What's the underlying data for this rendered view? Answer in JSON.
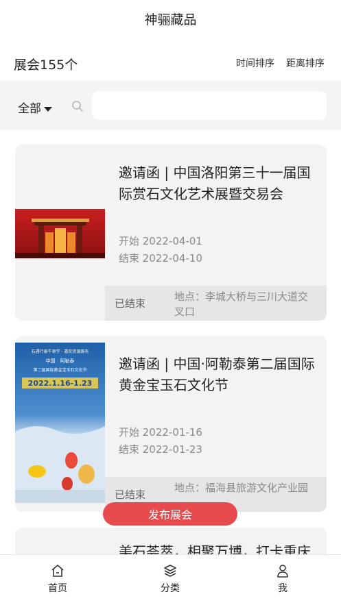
{
  "app": {
    "title": "神骊藏品"
  },
  "summary": {
    "count_label": "展会155个",
    "sort_time": "时间排序",
    "sort_distance": "距离排序"
  },
  "filter": {
    "category": "全部",
    "search_placeholder": "",
    "search_icon": "search-icon"
  },
  "exhibitions": [
    {
      "title": "邀请函 | 中国洛阳第三十一届国际赏石文化艺术展暨交易会",
      "start": "开始 2022-04-01",
      "end": "结束 2022-04-10",
      "status": "已结束",
      "location": "地点：李城大桥与三川大道交叉口"
    },
    {
      "title": "邀请函 | 中国·阿勒泰第二届国际黄金宝玉石文化节",
      "start": "开始 2022-01-16",
      "end": "结束 2022-01-23",
      "status": "已结束",
      "location": "地点：福海县旅游文化产业园",
      "poster": {
        "slogan": "石遇行泰牛顿学 · 邀实资源兼有",
        "org": "中国 · 阿勒泰",
        "event": "第二届国际黄金宝玉石文化节",
        "dates": "2022.1.16-1.23"
      }
    },
    {
      "title": "美石荟萃，相聚万博，打卡重庆"
    }
  ],
  "publish_button": "发布展会",
  "tabs": {
    "home": "首页",
    "category": "分类",
    "me": "我"
  },
  "colors": {
    "accent": "#e84b4d",
    "card_bg": "#f3f3f3",
    "footer_bg": "#e6e6e6"
  }
}
